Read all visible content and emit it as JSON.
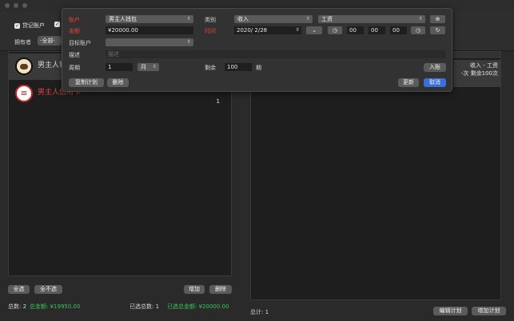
{
  "toolbar": {
    "checkbox_1_label": "贷记账户",
    "owner_label": "拥有者",
    "owner_value": "-全部-"
  },
  "accounts": [
    {
      "name": "男主人钱包",
      "icon": "wallet-avatar"
    },
    {
      "name": "男主人信用卡",
      "icon": "bank-avatar",
      "count": "1"
    }
  ],
  "left_panel": {
    "select_all": "全选",
    "deselect_all": "全不选",
    "add": "增加",
    "delete": "删除",
    "total_count_label": "总数: 2",
    "total_amount_label": "总金额: ¥19950.00",
    "selected_count_label": "已选总数: 1",
    "selected_amount_label": "已选总金额: ¥20000.00"
  },
  "right_panel": {
    "plan_line1": "收入 - 工资",
    "plan_line2": "-次  剩余100次",
    "total_label": "总计: 1",
    "edit_plan": "编辑计划",
    "add_plan": "增加计划"
  },
  "popover": {
    "account_label": "账户",
    "account_value": "男主人钱包",
    "amount_label": "金额",
    "amount_value": "¥20000.00",
    "target_label": "目标账户",
    "target_value": "",
    "category_label": "类别",
    "category_type": "收入",
    "category_value": "工资",
    "time_label": "时间",
    "date_value": "2020/ 2/28",
    "hour": "00",
    "minute": "00",
    "second": "00",
    "desc_label": "描述",
    "desc_placeholder": "描述",
    "period_label": "周期",
    "period_value": "1",
    "period_unit": "月",
    "remaining_label": "剩余",
    "remaining_value": "100",
    "remaining_unit": "期",
    "post_button": "入账",
    "copy_plan": "复制计划",
    "delete": "删除",
    "update": "更新",
    "cancel": "取消"
  },
  "colors": {
    "accent": "#3a6fd8",
    "positive": "#34c759",
    "label_red": "#e0443a"
  }
}
